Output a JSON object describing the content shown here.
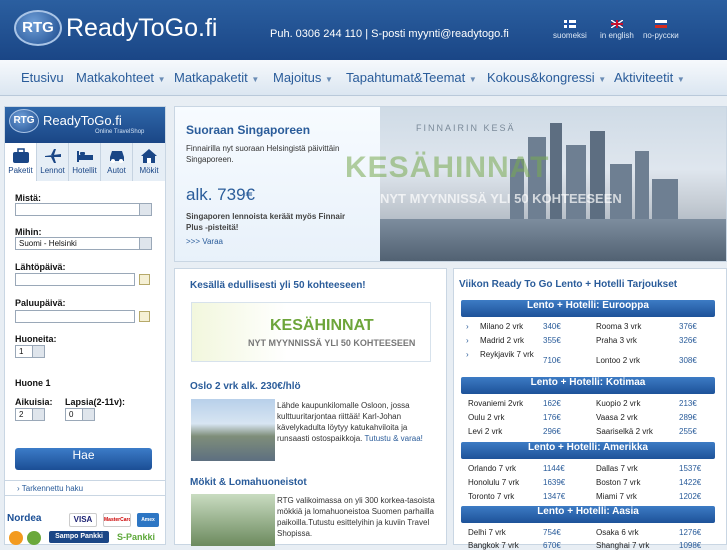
{
  "header": {
    "logo_badge": "RTG",
    "logo_text": "ReadyToGo.fi",
    "contact": "Puh. 0306 244 110 | S-posti myynti@readytogo.fi",
    "languages": [
      "suomeksi",
      "in english",
      "по-русски"
    ]
  },
  "nav": {
    "items": [
      "Etusivu",
      "Matkakohteet",
      "Matkapaketit",
      "Majoitus",
      "Tapahtumat&Teemat",
      "Kokous&kongressi",
      "Aktiviteetit"
    ]
  },
  "search": {
    "logo_badge": "RTG",
    "logo_text": "ReadyToGo.fi",
    "logo_sub": "Online TravelShop",
    "tabs": [
      "Paketit",
      "Lennot",
      "Hotellit",
      "Autot",
      "Mökit"
    ],
    "from_label": "Mistä:",
    "from_value": "",
    "to_label": "Mihin:",
    "to_value": "Suomi - Helsinki",
    "depart_label": "Lähtöpäivä:",
    "return_label": "Paluupäivä:",
    "rooms_label": "Huoneita:",
    "rooms_value": "1",
    "room1_label": "Huone 1",
    "adults_label": "Aikuisia:",
    "adults_value": "2",
    "children_label": "Lapsia(2-11v):",
    "children_value": "0",
    "search_button": "Hae",
    "advanced_link": "Tarkennettu haku",
    "payments": [
      "Nordea",
      "VISA",
      "MasterCard",
      "Amex",
      "Sampo Pankki",
      "S-Pankki"
    ]
  },
  "banner": {
    "title": "Suoraan Singaporeen",
    "text": "Finnairilla nyt suoraan Helsingistä päivittäin Singaporeen.",
    "price": "alk. 739€",
    "note": "Singaporen lennoista keräät myös Finnair Plus -pisteitä!",
    "link": ">>> Varaa",
    "overlay_label": "FINNAIRIN KESÄ",
    "overlay_big": "KESÄHINNAT",
    "overlay_sub": "NYT MYYNNISSÄ YLI 50 KOHTEESEEN"
  },
  "mid": {
    "heading1": "Kesällä edullisesti yli 50 kohteeseen!",
    "kh_title": "KESÄHINNAT",
    "kh_sub": "NYT MYYNNISSÄ YLI 50 KOHTEESEEN",
    "heading2": "Oslo 2 vrk alk. 230€/hlö",
    "oslo_text": "Lähde kaupunkilomalle Osloon, jossa kulttuuritarjontaa riittää! Karl-Johan kävelykadulta löytyy katukahviloita ja runsaasti ostospaikkoja.",
    "oslo_link": "Tutustu & varaa!",
    "heading3": "Mökit & Lomahuoneistot",
    "mokit_text": "RTG valikoimassa on yli 300 korkea-tasoista mökkiä ja lomahuoneistoa Suomen parhailla paikoilla.Tutustu esittelyihin ja kuviin Travel Shopissa."
  },
  "right": {
    "title": "Viikon Ready To Go Lento + Hotelli Tarjoukset",
    "sections": [
      {
        "title": "Lento + Hotelli: Eurooppa",
        "rows": [
          [
            "Milano 2 vrk",
            "340€",
            "Rooma 3 vrk",
            "376€"
          ],
          [
            "Madrid 2 vrk",
            "355€",
            "Praha 3 vrk",
            "326€"
          ],
          [
            "Reykjavik 7 vrk",
            "710€",
            "Lontoo 2 vrk",
            "308€"
          ]
        ]
      },
      {
        "title": "Lento + Hotelli: Kotimaa",
        "rows": [
          [
            "Rovaniemi 2vrk",
            "162€",
            "Kuopio 2 vrk",
            "213€"
          ],
          [
            "Oulu 2 vrk",
            "176€",
            "Vaasa 2 vrk",
            "289€"
          ],
          [
            "Levi 2 vrk",
            "296€",
            "Saariselkä 2 vrk",
            "255€"
          ]
        ]
      },
      {
        "title": "Lento + Hotelli: Amerikka",
        "rows": [
          [
            "Orlando 7 vrk",
            "1144€",
            "Dallas 7 vrk",
            "1537€"
          ],
          [
            "Honolulu 7 vrk",
            "1639€",
            "Boston 7 vrk",
            "1422€"
          ],
          [
            "Toronto 7 vrk",
            "1347€",
            "Miami 7 vrk",
            "1202€"
          ]
        ]
      },
      {
        "title": "Lento + Hotelli: Aasia",
        "rows": [
          [
            "Delhi 7 vrk",
            "754€",
            "Osaka 6 vrk",
            "1276€"
          ],
          [
            "Bangkok 7 vrk",
            "670€",
            "Shanghai 7 vrk",
            "1098€"
          ]
        ]
      }
    ]
  }
}
